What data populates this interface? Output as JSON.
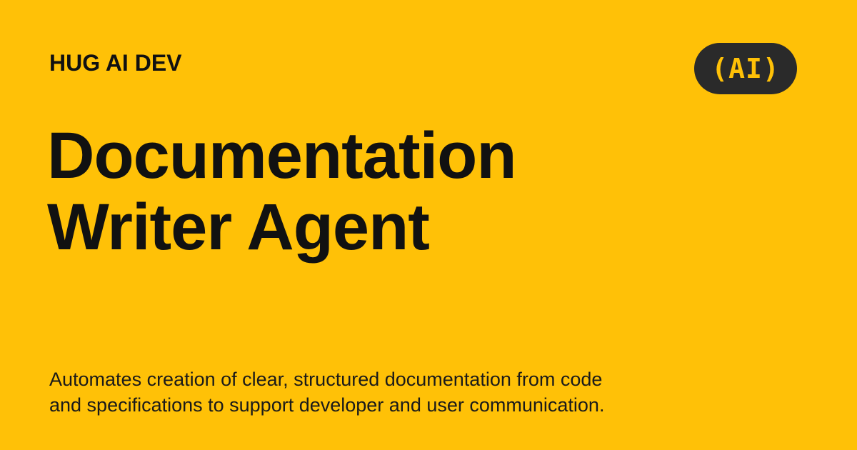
{
  "brand": {
    "name": "HUG AI DEV",
    "logo_text": "(AI)"
  },
  "title": {
    "line1": "Documentation",
    "line2": "Writer Agent"
  },
  "description": {
    "line1": "Automates creation of clear, structured documentation from code",
    "line2": "and specifications to support developer and user communication."
  },
  "colors": {
    "background": "#FFC107",
    "text": "#111111",
    "logo_badge": "#2A2A2A",
    "logo_text": "#FFC107"
  }
}
